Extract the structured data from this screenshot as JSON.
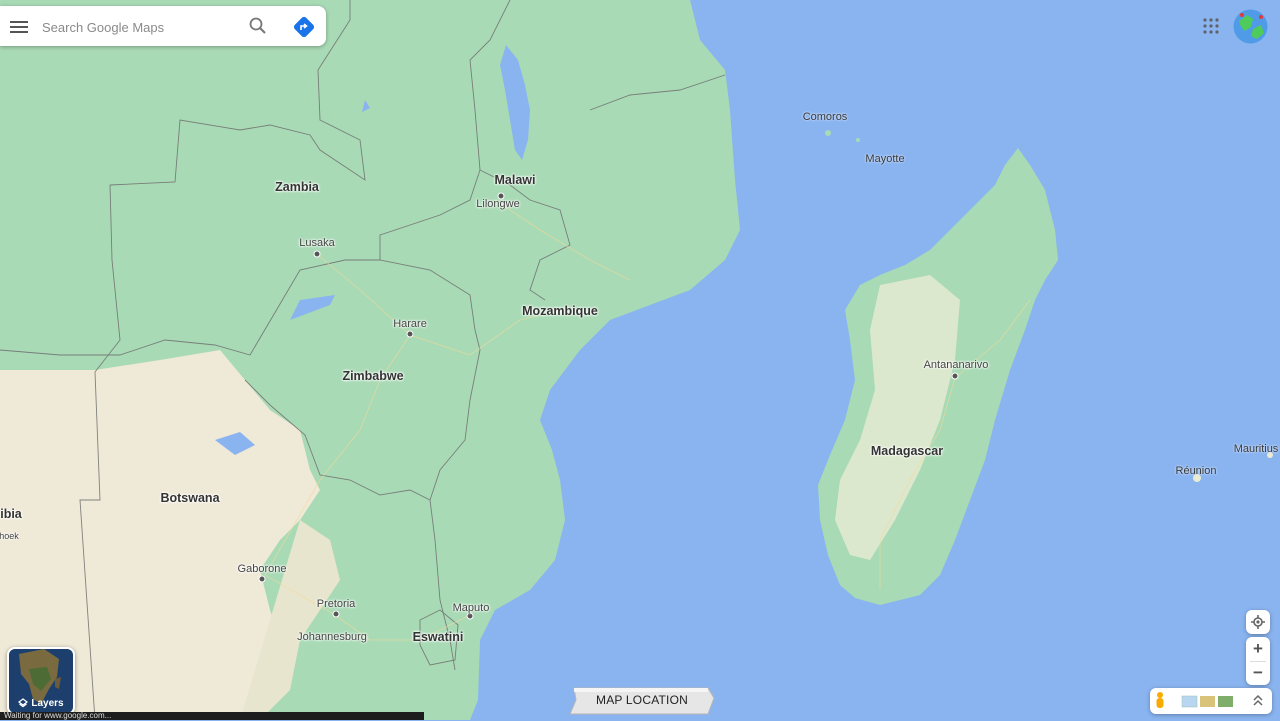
{
  "search": {
    "placeholder": "Search Google Maps"
  },
  "icons": {
    "menu": "hamburger-menu-icon",
    "search": "search-icon",
    "directions": "directions-icon",
    "apps": "google-apps-icon",
    "account": "account-avatar-icon",
    "layers": "layers-icon",
    "location": "my-location-icon",
    "pegman": "pegman-icon",
    "expand": "expand-up-icon"
  },
  "colors": {
    "water": "#8ab4f0",
    "land_green": "#a8dab5",
    "land_sand": "#f1ebdc",
    "borders": "#6f6f6f",
    "accent": "#1a73e8"
  },
  "labels": {
    "countries": [
      "Zambia",
      "Malawi",
      "Mozambique",
      "Zimbabwe",
      "Botswana",
      "Madagascar",
      "Eswatini",
      "ibia"
    ],
    "cities": [
      "Lilongwe",
      "Lusaka",
      "Harare",
      "Antananarivo",
      "Gaborone",
      "Pretoria",
      "Johannesburg",
      "Maputo",
      "hoek"
    ],
    "islands": [
      "Comoros",
      "Mayotte",
      "Réunion",
      "Mauritius"
    ]
  },
  "layers": {
    "label": "Layers"
  },
  "status": {
    "text": "Waiting for www.google.com..."
  },
  "banner": {
    "text": "MAP LOCATION"
  },
  "zoom": {
    "in": "+",
    "out": "−"
  }
}
